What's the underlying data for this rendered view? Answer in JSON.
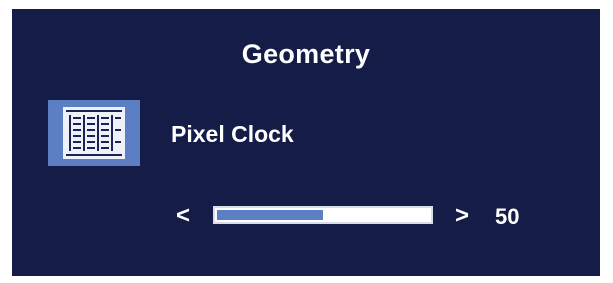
{
  "menu": {
    "title": "Geometry"
  },
  "item": {
    "icon": "pixel-clock-icon",
    "label": "Pixel Clock"
  },
  "slider": {
    "decrease_glyph": "<",
    "increase_glyph": ">",
    "value": "50",
    "fraction": 0.5
  },
  "colors": {
    "background": "#141c47",
    "accent": "#5c7fc4",
    "text": "#ffffff"
  }
}
